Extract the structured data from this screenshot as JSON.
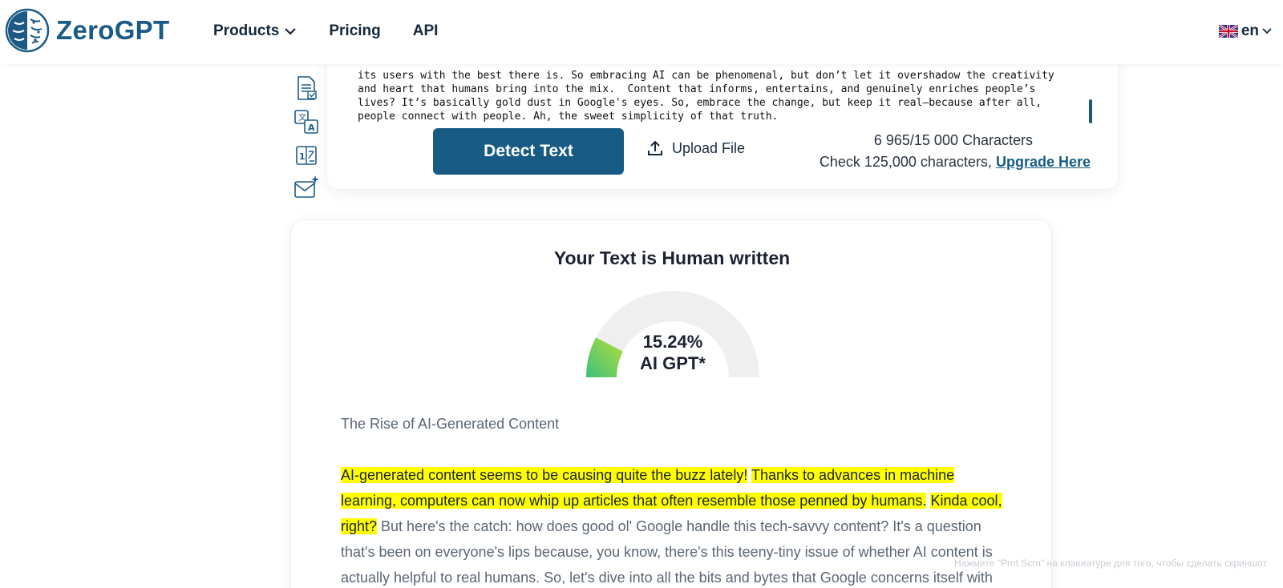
{
  "header": {
    "logo_text": "ZeroGPT",
    "nav": [
      {
        "label": "Products",
        "has_dropdown": true
      },
      {
        "label": "Pricing",
        "has_dropdown": false
      },
      {
        "label": "API",
        "has_dropdown": false
      }
    ],
    "language": "en"
  },
  "input_card": {
    "text": "its users with the best there is. So embracing AI can be phenomenal, but don’t let it overshadow the creativity\nand heart that humans bring into the mix.  Content that informs, entertains, and genuinely enriches people’s\nlives? It’s basically gold dust in Google's eyes. So, embrace the change, but keep it real—because after all,\npeople connect with people. Ah, the sweet simplicity of that truth.",
    "detect_button": "Detect Text",
    "upload_label": "Upload File",
    "char_count": "6 965/15 000 Characters",
    "upgrade_prefix": "Check 125,000 characters,",
    "upgrade_link": "Upgrade Here"
  },
  "result": {
    "title": "Your Text is Human written",
    "percent_label": "15.24%",
    "percent_value": 15.24,
    "gauge_caption": "AI GPT*",
    "content_title": "The Rise of AI-Generated Content",
    "paragraph": [
      {
        "text": "AI-generated content seems to be causing quite the buzz lately!",
        "highlighted": true
      },
      {
        "text": " ",
        "highlighted": false
      },
      {
        "text": "Thanks to advances in machine learning, computers can now whip up articles that often resemble those penned by humans.",
        "highlighted": true
      },
      {
        "text": " ",
        "highlighted": false
      },
      {
        "text": "Kinda cool, right?",
        "highlighted": true
      },
      {
        "text": " But here's the catch: how does good ol' Google handle this tech-savvy content? It's a question that's been on everyone's lips because, you know, there's this teeny-tiny issue of whether AI content is actually helpful to real humans. So, let's dive into all the bits and bytes that Google concerns itself with regarding AI-",
        "highlighted": false
      }
    ]
  },
  "watermark": "Нажмите \"Prnt Scrn\" на клавиатуре для того, чтобы сделать скриншот",
  "colors": {
    "brand": "#175b85",
    "highlight": "#ffff00",
    "gauge_fill_start": "#3cc27b",
    "gauge_fill_end": "#b7dd3a",
    "gauge_track": "#efefef"
  }
}
